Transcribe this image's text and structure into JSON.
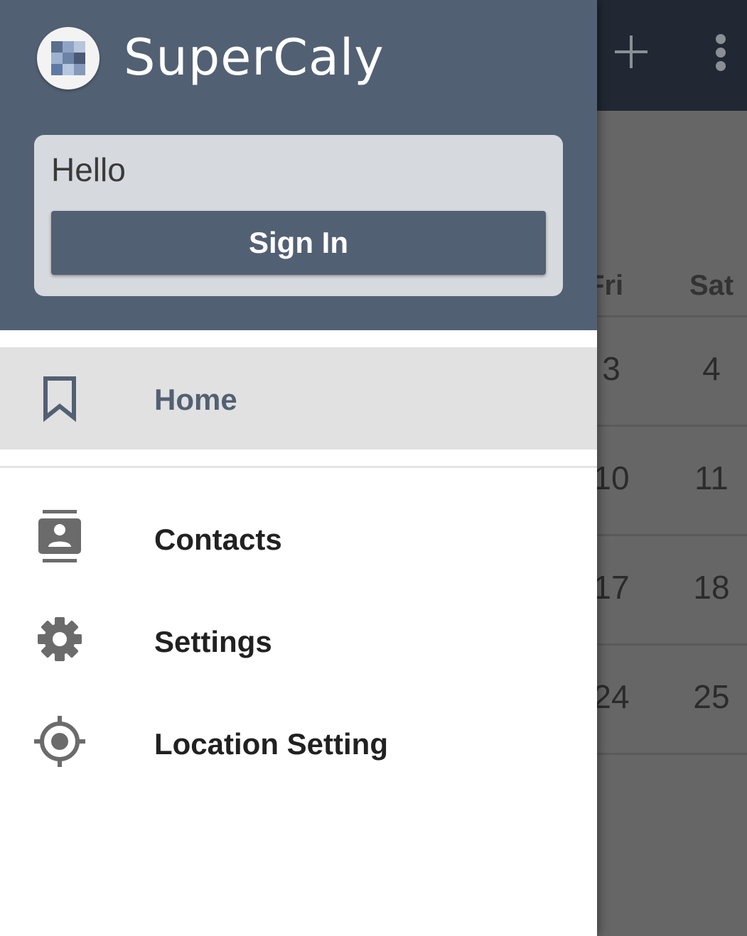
{
  "app": {
    "title": "SuperCaly"
  },
  "account": {
    "greeting": "Hello",
    "sign_in_label": "Sign In"
  },
  "nav": {
    "items": [
      {
        "label": "Home",
        "icon": "bookmark-icon",
        "active": true
      },
      {
        "label": "Contacts",
        "icon": "contacts-icon",
        "active": false
      },
      {
        "label": "Settings",
        "icon": "gear-icon",
        "active": false
      },
      {
        "label": "Location Setting",
        "icon": "location-target-icon",
        "active": false
      }
    ]
  },
  "background": {
    "toolbar_icons": [
      "add-icon",
      "more-vert-icon"
    ],
    "day_headers": [
      "Fri",
      "Sat"
    ],
    "weeks": [
      {
        "fri": "3",
        "sat": "4"
      },
      {
        "fri": "10",
        "sat": "11"
      },
      {
        "fri": "17",
        "sat": "18"
      },
      {
        "fri": "24",
        "sat": "25"
      }
    ]
  },
  "colors": {
    "primary": "#526073",
    "toolbar_dark": "#212833",
    "active_row": "#e1e1e1",
    "scrim": "#666666"
  }
}
